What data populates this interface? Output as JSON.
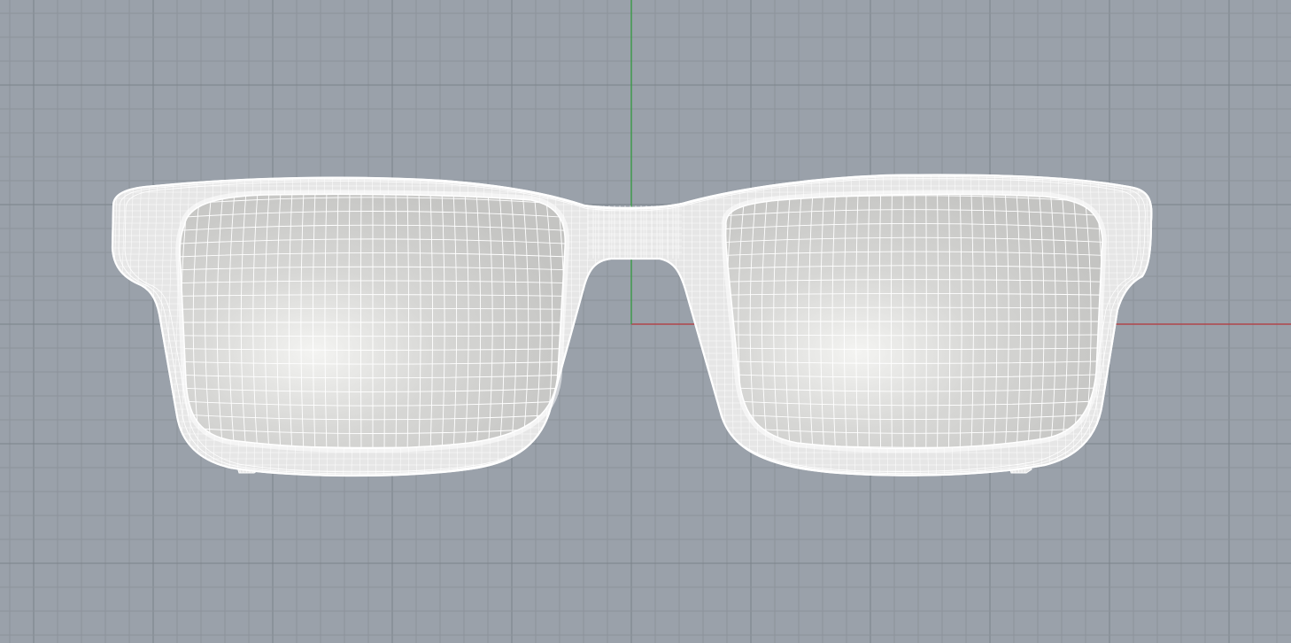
{
  "viewport": {
    "view": "front",
    "mode": "wireframe"
  },
  "colors": {
    "background": "#9aa1aa",
    "grid_minor": "#8c939b",
    "grid_major": "#7b828a",
    "axis_x": "#b0454b",
    "axis_y": "#3f9a4c",
    "frame_fill": "#e6e6e6",
    "lens_fill": "#d9d9d9",
    "wire": "#ffffff"
  },
  "model": {
    "object": "eyeglasses-frame",
    "display": "surface-isocurves"
  }
}
